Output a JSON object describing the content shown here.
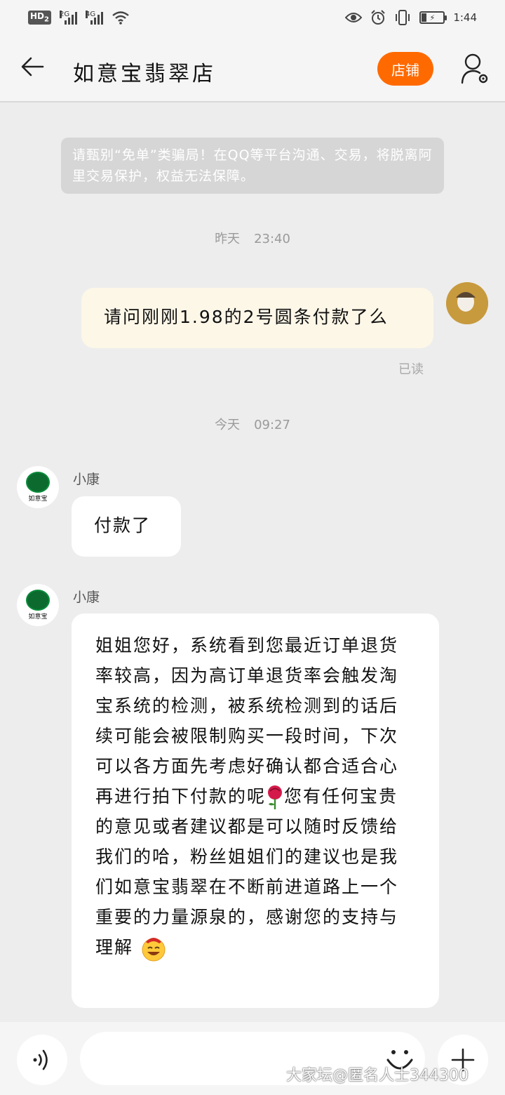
{
  "status_bar": {
    "hd_label": "HD",
    "hd_sub": "2",
    "sig1_tag": "2G",
    "sig2_tag": "4G",
    "time": "1:44"
  },
  "header": {
    "title": "如意宝翡翠店",
    "store_button": "店铺",
    "back_icon": "arrow-left-icon",
    "user_icon": "user-settings-icon"
  },
  "notice": "请甄别“免单”类骗局！在QQ等平台沟通、交易，将脱离阿里交易保护，权益无法保障。",
  "time_separators": [
    {
      "day": "昨天",
      "time": "23:40"
    },
    {
      "day": "今天",
      "time": "09:27"
    }
  ],
  "messages": {
    "outgoing": {
      "text": "请问刚刚1.98的2号圆条付款了么",
      "read_status": "已读"
    },
    "incoming": [
      {
        "sender": "小康",
        "text": "付款了"
      },
      {
        "sender": "小康",
        "text_part1": "姐姐您好，系统看到您最近订单退货率较高，因为高订单退货率会触发淘宝系统的检测，被系统检测到的话后续可能会被限制购买一段时间，下次可以各方面先考虑好确认都合适合心再进行拍下付款的呢",
        "text_part2": "您有任何宝贵的意见或者建议都是可以随时反馈给我们的哈，粉丝姐姐们的建议也是我们如意宝翡翠在不断前进道路上一个重要的力量源泉的，感谢您的支持与理解"
      }
    ]
  },
  "shop_avatar": {
    "logo_text": "如意宝",
    "sub_text": "RYB JEWELRY"
  },
  "input_bar": {
    "placeholder": ""
  },
  "watermark": "大家坛@匿名人士344300",
  "colors": {
    "accent": "#ff6a00",
    "background": "#ededed",
    "outgoing_bubble": "#fdf7e8",
    "incoming_bubble": "#ffffff",
    "notice_bg": "#d6d6d6"
  }
}
